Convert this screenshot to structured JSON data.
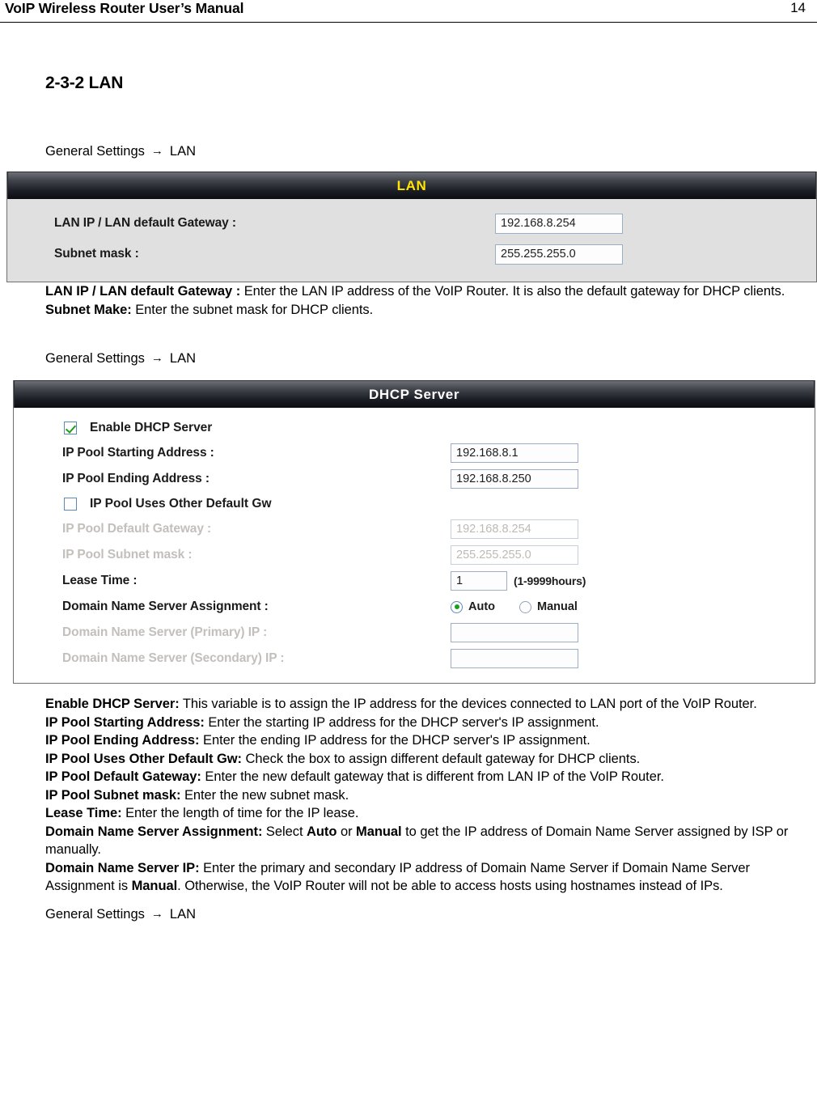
{
  "header": {
    "doc_title": "VoIP Wireless Router User’s Manual",
    "page_number": "14"
  },
  "section": {
    "title": "2-3-2 LAN"
  },
  "breadcrumbs": {
    "first": "General Settings",
    "arrow": "→",
    "last": "LAN"
  },
  "lan_panel": {
    "title": "LAN",
    "title_color": "#ffe600",
    "rows": [
      {
        "label": "LAN IP / LAN default Gateway :",
        "value": "192.168.8.254"
      },
      {
        "label": "Subnet mask :",
        "value": "255.255.255.0"
      }
    ]
  },
  "lan_descriptions": [
    {
      "term": "LAN IP / LAN default Gateway :",
      "text": " Enter the LAN IP address of the VoIP Router. It is also the default gateway for DHCP clients."
    },
    {
      "term": "Subnet Make:",
      "text": " Enter the subnet mask for DHCP clients."
    }
  ],
  "dhcp_panel": {
    "title": "DHCP Server",
    "title_color": "#ffffff",
    "enable_checkbox": {
      "label": "Enable DHCP Server",
      "checked": true
    },
    "ip_pool_start": {
      "label": "IP Pool Starting Address :",
      "value": "192.168.8.1"
    },
    "ip_pool_end": {
      "label": "IP Pool Ending Address :",
      "value": "192.168.8.250"
    },
    "other_gw_checkbox": {
      "label": "IP Pool Uses Other Default Gw",
      "checked": false
    },
    "pool_default_gateway": {
      "label": "IP Pool Default Gateway :",
      "value": "192.168.8.254"
    },
    "pool_subnet_mask": {
      "label": "IP Pool Subnet mask :",
      "value": "255.255.255.0"
    },
    "lease_time": {
      "label": "Lease Time :",
      "value": "1",
      "hint": "(1-9999hours)"
    },
    "dns_assignment": {
      "label": "Domain Name Server Assignment :",
      "options": [
        {
          "label": "Auto",
          "selected": true
        },
        {
          "label": "Manual",
          "selected": false
        }
      ]
    },
    "dns_primary": {
      "label": "Domain Name Server (Primary) IP :",
      "value": ""
    },
    "dns_secondary": {
      "label": "Domain Name Server (Secondary) IP :",
      "value": ""
    }
  },
  "dhcp_descriptions": [
    {
      "term": "Enable DHCP Server:",
      "text": " This variable is to assign the IP address for the devices connected to LAN port of the VoIP Router."
    },
    {
      "term": "IP Pool Starting Address:",
      "text": " Enter the starting IP address for the DHCP server's IP assignment."
    },
    {
      "term": "IP Pool Ending Address:",
      "text": " Enter the ending IP address for the DHCP server's IP assignment."
    },
    {
      "term": "IP Pool Uses Other Default Gw:",
      "text": " Check the box to assign different default gateway for DHCP clients."
    },
    {
      "term": "IP Pool Default Gateway:",
      "text": " Enter the new default gateway that is different from LAN IP of the VoIP Router."
    },
    {
      "term": "IP Pool Subnet mask:",
      "text": " Enter the new subnet mask."
    },
    {
      "term": "Lease Time:",
      "text": " Enter the length of time for the IP lease."
    }
  ],
  "dns_description": {
    "term": "Domain Name Server Assignment:",
    "part1": " Select ",
    "bold1": "Auto",
    "part2": " or ",
    "bold2": "Manual",
    "part3": " to get the IP address of Domain Name Server assigned by ISP or manually."
  },
  "dns_ip_description": {
    "term": "Domain Name Server IP:",
    "part1": " Enter the primary and secondary IP address of Domain Name Server if Domain Name Server Assignment is ",
    "bold1": "Manual",
    "part2": ". Otherwise, the VoIP Router will not be able to access hosts using hostnames instead of IPs."
  }
}
